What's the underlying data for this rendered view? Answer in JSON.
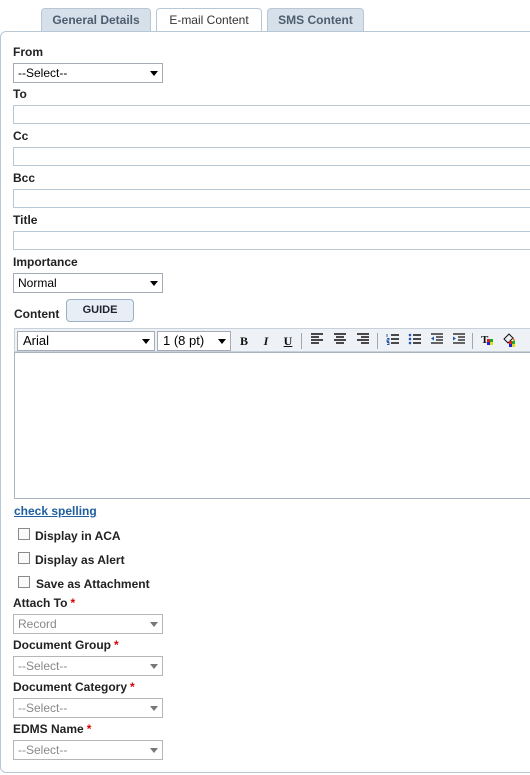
{
  "tabs": [
    "General Details",
    "E-mail Content",
    "SMS Content"
  ],
  "from": {
    "label": "From",
    "value": "--Select--"
  },
  "to": {
    "label": "To"
  },
  "cc": {
    "label": "Cc"
  },
  "bcc": {
    "label": "Bcc"
  },
  "title": {
    "label": "Title"
  },
  "importance": {
    "label": "Importance",
    "value": "Normal"
  },
  "content": {
    "label": "Content",
    "guide": "GUIDE",
    "font": "Arial",
    "size": "1 (8 pt)",
    "bold": "B",
    "italic": "I",
    "underline": "U"
  },
  "check_spelling": "check spelling",
  "checkboxes": [
    "Display in ACA",
    "Display as Alert",
    "Save as Attachment"
  ],
  "attach_to": {
    "label": "Attach To",
    "value": "Record"
  },
  "document_group": {
    "label": "Document Group",
    "value": "--Select--"
  },
  "document_category": {
    "label": "Document Category",
    "value": "--Select--"
  },
  "edms_name": {
    "label": "EDMS Name",
    "value": "--Select--"
  },
  "required_mark": "*"
}
